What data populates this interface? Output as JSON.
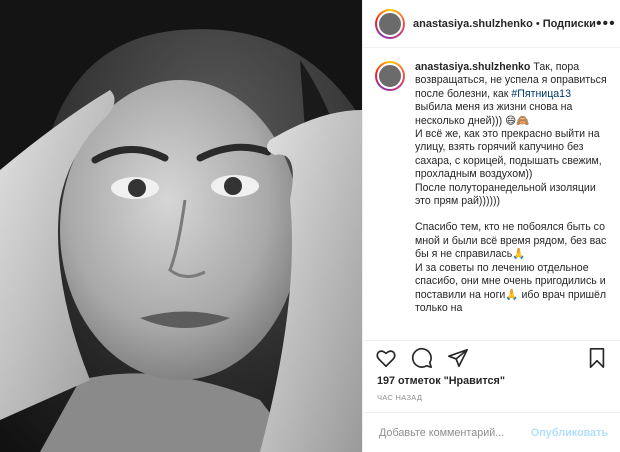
{
  "post": {
    "username": "anastasiya.shulzhenko",
    "follow_label": "Подписки",
    "more_label": "•••",
    "caption": {
      "username": "anastasiya.shulzhenko",
      "lines_before_tag": "Так, пора возвращаться, не успела я оправиться после болезни, как ",
      "hashtag": "#Пятница13",
      "lines_after_tag": " выбила меня из жизни снова на несколько дней))) 😄🙈\nИ всё же, как это прекрасно выйти на улицу, взять горячий капучино без сахара, с корицей, подышать свежим, прохладным воздухом))\nПосле полуторанедельной изоляции это прям рай))))))",
      "paragraph2": "Спасибо тем, кто не побоялся быть со мной и были всё время рядом, без вас бы я не справилась🙏\nИ за советы по лечению отдельное спасибо, они мне очень пригодились и поставили на ноги🙏 ибо врач пришёл только на"
    },
    "likes_text": "197 отметок \"Нравится\"",
    "time_text": "час назад",
    "comment_placeholder": "Добавьте комментарий...",
    "publish_label": "Опубликовать",
    "icons": {
      "like": "heart-icon",
      "comment": "comment-icon",
      "share": "share-icon",
      "save": "bookmark-icon",
      "more": "more-icon"
    },
    "colors": {
      "link": "#00376b",
      "publish_disabled": "#b2dffc",
      "secondary_text": "#8e8e8e"
    }
  }
}
